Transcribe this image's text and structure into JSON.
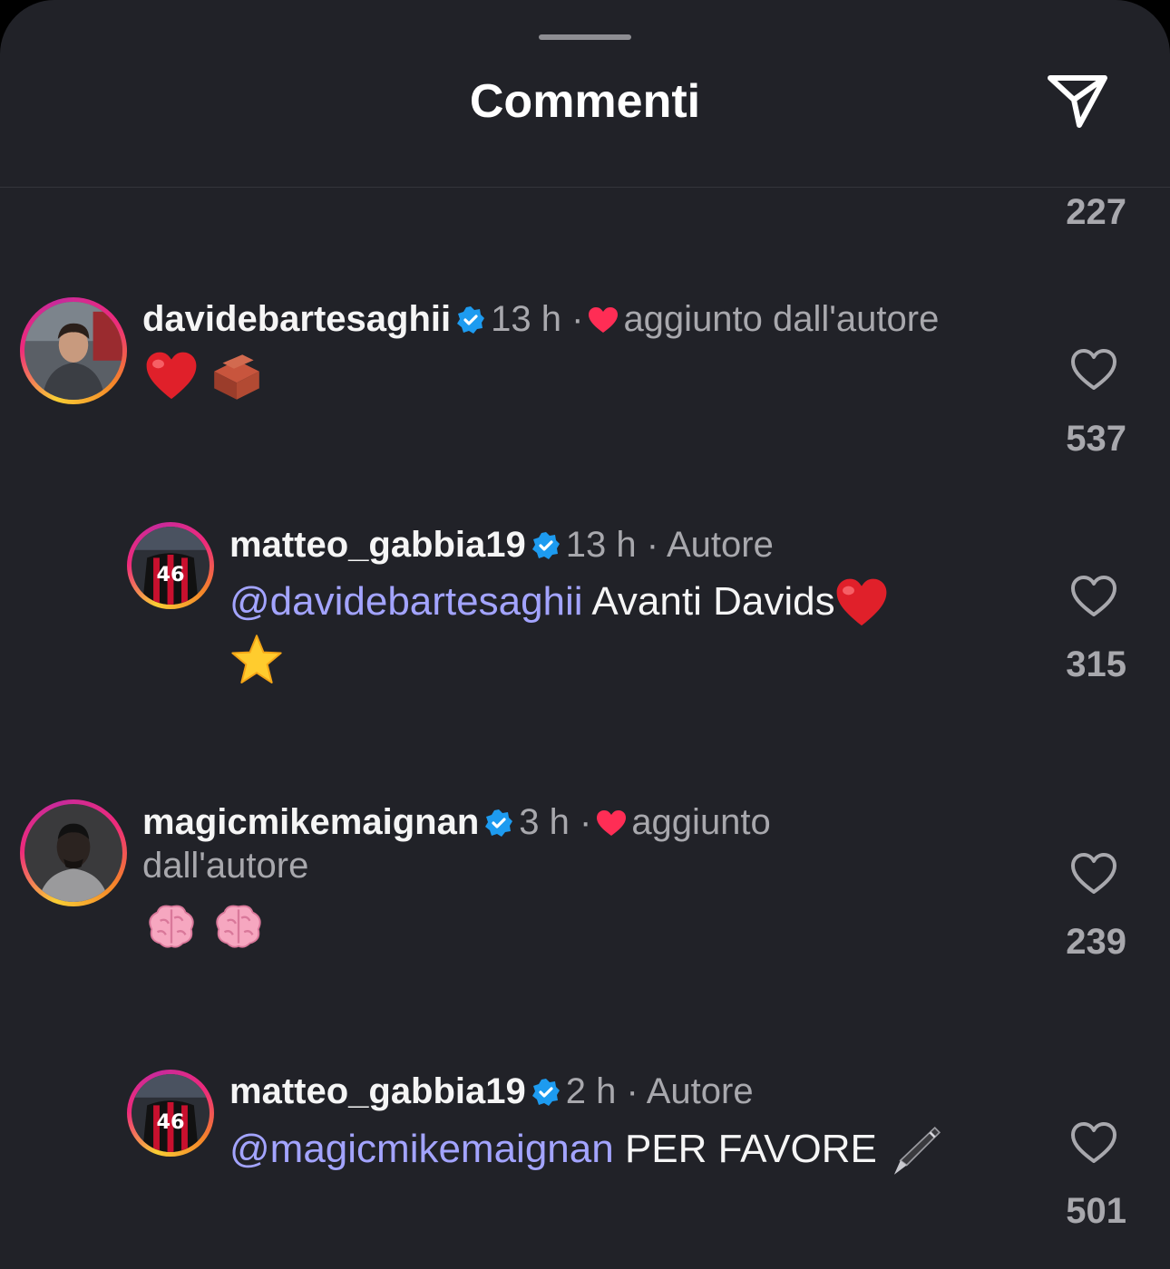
{
  "header": {
    "title": "Commenti",
    "send_icon": "paper-plane-icon"
  },
  "top_like_count": "227",
  "comments": [
    {
      "username": "davidebartesaghii",
      "time": "13 h",
      "separator": "·",
      "liked_by_author_text": "aggiunto dall'autore",
      "text_emojis": [
        "red-heart",
        "brick"
      ],
      "like_count": "537"
    },
    {
      "username": "matteo_gabbia19",
      "time": "13 h",
      "separator": "·",
      "author_label": "Autore",
      "mention": "@davidebartesaghii",
      "text": "Avanti Davids",
      "text_emojis": [
        "red-heart",
        "star"
      ],
      "like_count": "315",
      "jersey_number": "46"
    },
    {
      "username": "magicmikemaignan",
      "time": "3 h",
      "separator": "·",
      "liked_by_author_text_1": "aggiunto",
      "liked_by_author_text_2": "dall'autore",
      "text_emojis": [
        "brain",
        "brain"
      ],
      "like_count": "239"
    },
    {
      "username": "matteo_gabbia19",
      "time": "2 h",
      "separator": "·",
      "author_label": "Autore",
      "mention": "@magicmikemaignan",
      "text": "PER FAVORE",
      "text_emojis": [
        "pen"
      ],
      "like_count": "501",
      "jersey_number": "46"
    }
  ],
  "colors": {
    "background": "#212228",
    "mention": "#a3a4ff",
    "verified": "#1d9bf0",
    "author_heart": "#ff2d55",
    "secondary_text": "#a8a8ad"
  }
}
